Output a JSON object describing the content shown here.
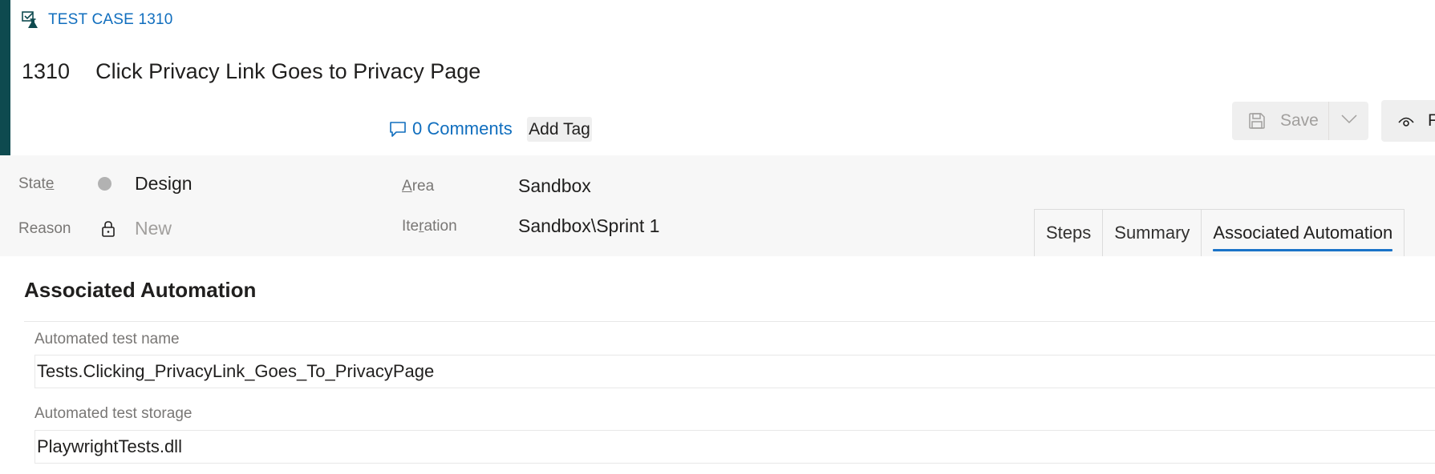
{
  "header": {
    "type_icon": "test-case-icon",
    "type_label": "TEST CASE 1310",
    "work_item_id": "1310",
    "title": "Click Privacy Link Goes to Privacy Page",
    "comments_icon": "comment-icon",
    "comments_label": "0 Comments",
    "add_tag_label": "Add Tag",
    "save_icon": "save-icon",
    "save_label": "Save",
    "save_dropdown_icon": "chevron-down-icon",
    "follow_icon": "eye-icon",
    "follow_label": "F"
  },
  "fields": {
    "state": {
      "label_pre": "Stat",
      "label_key": "e",
      "label_post": "",
      "value": "Design",
      "dot_color": "#b2b2b2"
    },
    "reason": {
      "label": "Reason",
      "value": "New",
      "icon": "lock-icon"
    },
    "area": {
      "label_pre": "",
      "label_key": "A",
      "label_post": "rea",
      "value": "Sandbox"
    },
    "iteration": {
      "label_pre": "Ite",
      "label_key": "r",
      "label_post": "ation",
      "value": "Sandbox\\Sprint 1"
    }
  },
  "tabs": [
    {
      "label": "Steps",
      "active": false
    },
    {
      "label": "Summary",
      "active": false
    },
    {
      "label": "Associated Automation",
      "active": true
    }
  ],
  "automation": {
    "section_title": "Associated Automation",
    "test_name_label": "Automated test name",
    "test_name_value": "Tests.Clicking_PrivacyLink_Goes_To_PrivacyPage",
    "test_storage_label": "Automated test storage",
    "test_storage_value": "PlaywrightTests.dll"
  },
  "colors": {
    "accent_bar": "#0e4a4f",
    "link": "#106ebe",
    "active_tab_underline": "#1a73c8"
  }
}
